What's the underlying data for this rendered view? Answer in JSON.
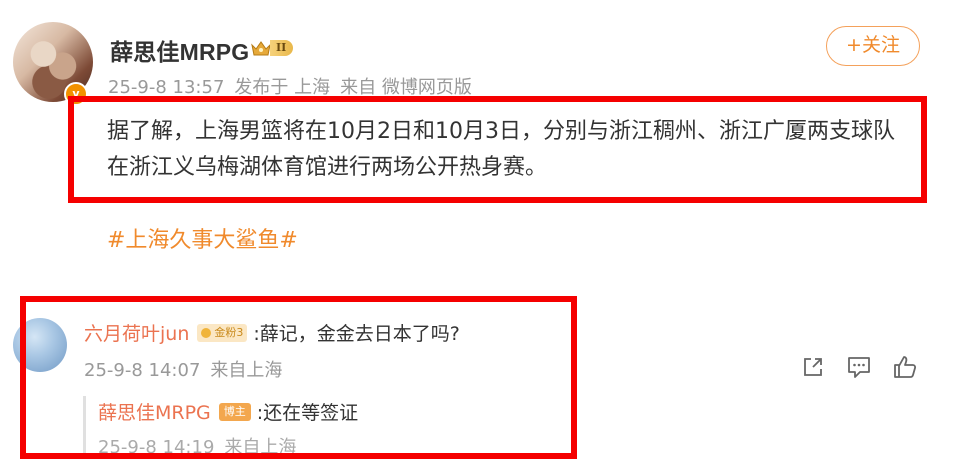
{
  "post": {
    "username": "薛思佳MRPG",
    "level_badge": "II",
    "date": "25-9-8 13:57",
    "published_at": "发布于 上海",
    "source": "来自 微博网页版",
    "follow_label": "+关注",
    "text": "据了解，上海男篮将在10月2日和10月3日，分别与浙江稠州、浙江广厦两支球队在浙江义乌梅湖体育馆进行两场公开热身赛。",
    "hashtag": "#上海久事大鲨鱼#"
  },
  "comment": {
    "username": "六月荷叶jun",
    "fan_badge": "金粉3",
    "text": ":薛记，金金去日本了吗?",
    "date": "25-9-8 14:07",
    "location": "来自上海",
    "actions": [
      "share-icon",
      "comment-icon",
      "like-icon"
    ],
    "reply": {
      "username": "薛思佳MRPG",
      "role_badge": "博主",
      "text": ":还在等签证",
      "date": "25-9-8 14:19",
      "location": "来自上海"
    }
  },
  "colors": {
    "accent": "#f08a2c",
    "username_link": "#eb7350",
    "annotation_red": "#f50000"
  }
}
